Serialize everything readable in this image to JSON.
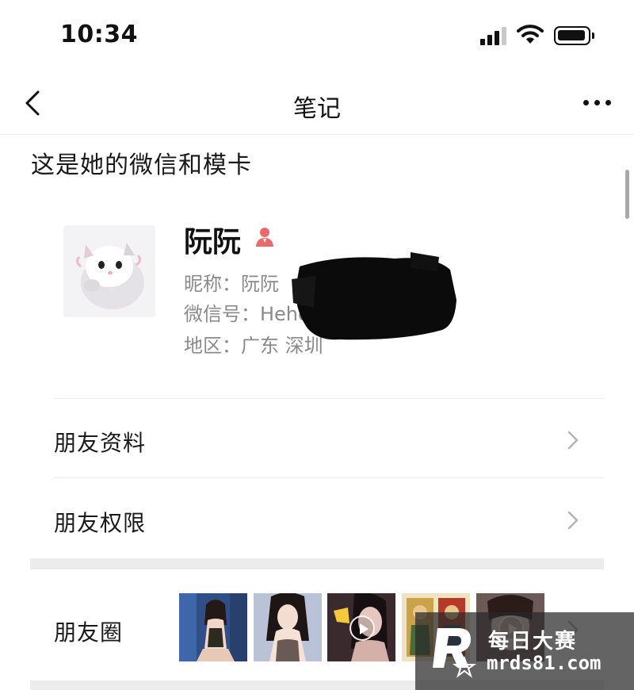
{
  "status_bar": {
    "time": "10:34"
  },
  "nav": {
    "title": "笔记"
  },
  "note": {
    "text": "这是她的微信和模卡"
  },
  "contact": {
    "name": "阮阮",
    "nickname": "昵称：阮阮",
    "wechat_id": "微信号：Hehe",
    "region": "地区：广东  深圳"
  },
  "menu": {
    "friend_profile": "朋友资料",
    "friend_permissions": "朋友权限",
    "moments": "朋友圈"
  },
  "watermark": {
    "title": "每日大赛",
    "url": "mrds81.com"
  },
  "colors": {
    "accent_gender": "#e86a6a",
    "divider": "#ececec",
    "secondary_text": "#8a8a8a"
  }
}
